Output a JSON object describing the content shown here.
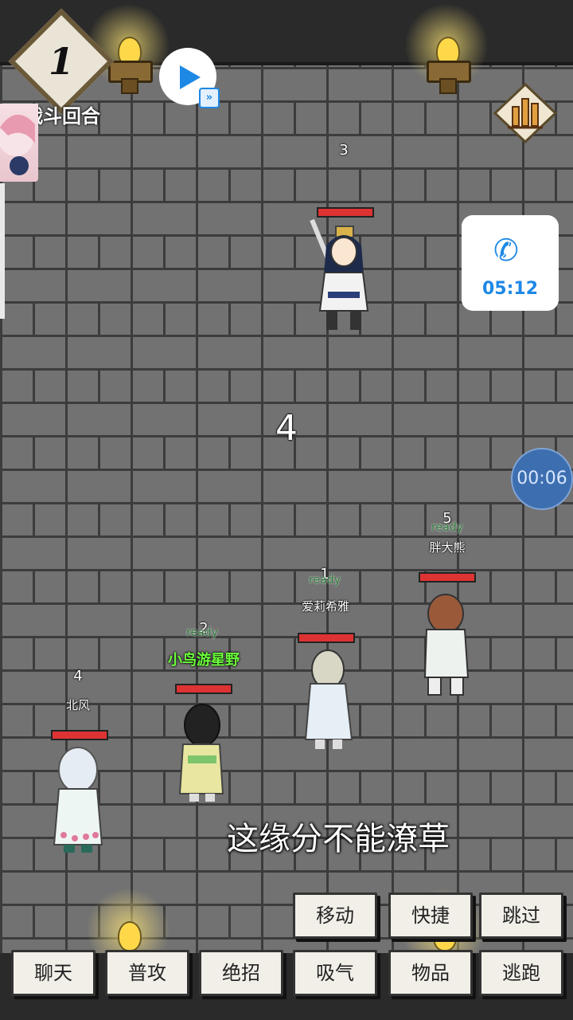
{
  "hud": {
    "round_number": "1",
    "round_label": "战斗回合",
    "turn_countdown": "4",
    "stats_icon": "bar-chart-icon"
  },
  "overlay": {
    "call_time": "05:12",
    "record_timer": "00:06",
    "phone_icon": "phone-icon",
    "play_icon": "play-icon"
  },
  "enemy": {
    "order": "3",
    "hp_fraction": 0.95
  },
  "party": [
    {
      "order": "5",
      "status": "ready",
      "name": "胖大熊",
      "hp_fraction": 0.97
    },
    {
      "order": "1",
      "status": "ready",
      "name": "爱莉希雅",
      "hp_fraction": 0.97
    },
    {
      "order": "2",
      "status": "ready",
      "name": "小鸟游星野",
      "hp_fraction": 0.97
    },
    {
      "order": "4",
      "status": "",
      "name": "北风",
      "hp_fraction": 0.97
    }
  ],
  "subtitle": "这缘分不能潦草",
  "actions_top": [
    "移动",
    "快捷",
    "跳过"
  ],
  "actions_bottom": [
    "聊天",
    "普攻",
    "绝招",
    "吸气",
    "物品",
    "逃跑"
  ],
  "colors": {
    "hp": "#dd3333",
    "accent": "#1e88e5",
    "ready": "#2d7a3a",
    "highlight_name": "#6bff3a"
  }
}
